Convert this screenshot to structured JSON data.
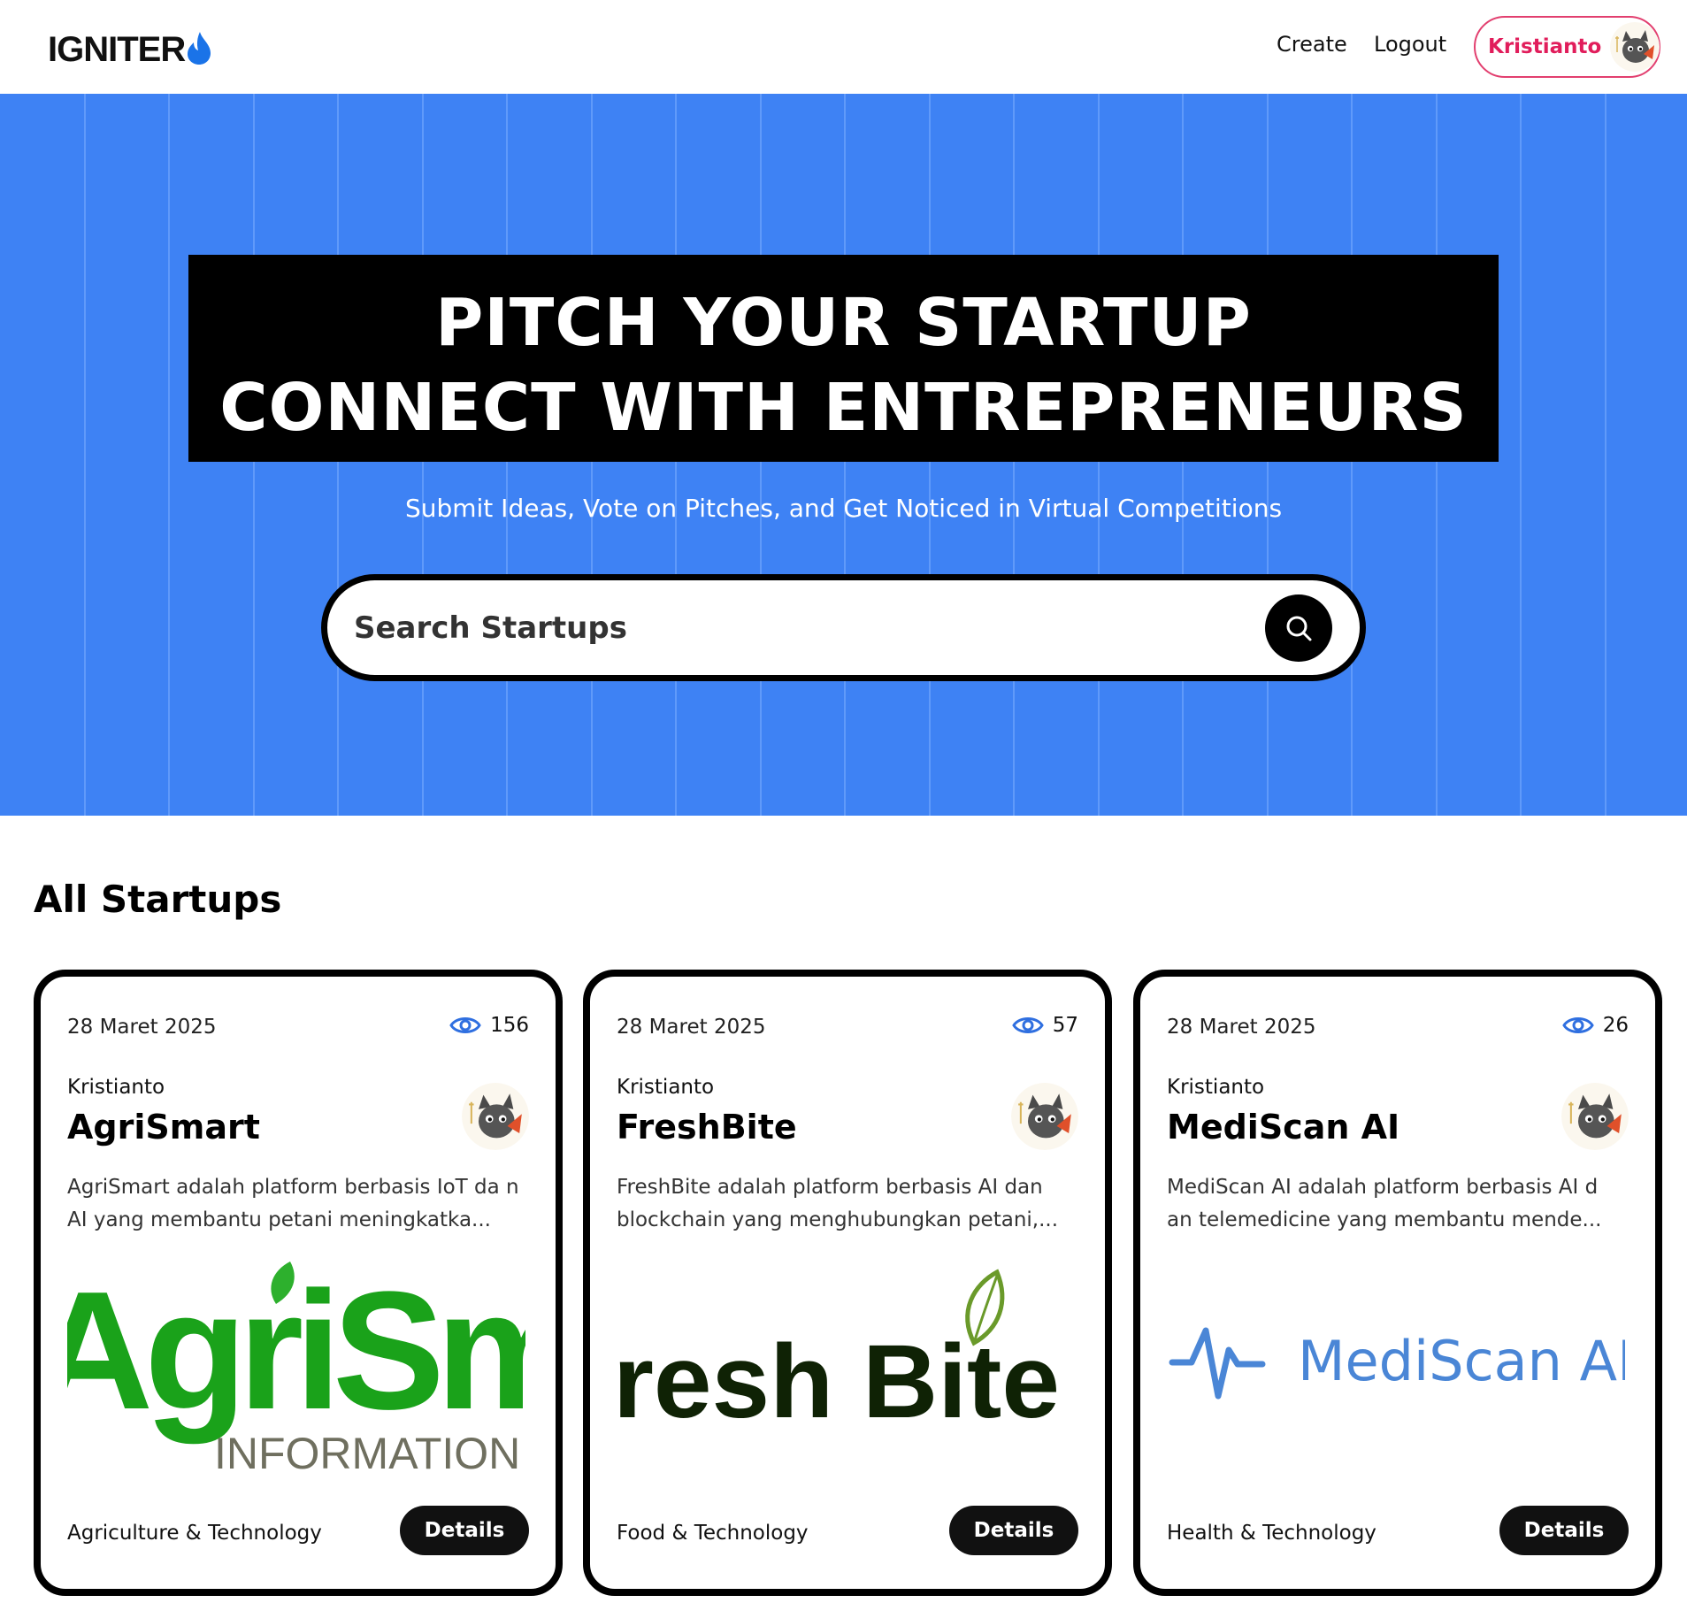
{
  "nav": {
    "logo_text": "IGNITER",
    "create_label": "Create",
    "logout_label": "Logout",
    "user_name": "Kristianto"
  },
  "hero": {
    "headline_line1": "PITCH YOUR STARTUP",
    "headline_line2": "CONNECT WITH ENTREPRENEURS",
    "subtitle": "Submit Ideas, Vote on Pitches, and Get Noticed in Virtual Competitions",
    "search_placeholder": "Search Startups"
  },
  "section": {
    "title": "All Startups"
  },
  "cards": [
    {
      "date": "28 Maret 2025",
      "views": "156",
      "author": "Kristianto",
      "title": "AgriSmart",
      "description": "AgriSmart adalah platform berbasis IoT da n AI yang membantu petani meningkatka...",
      "category": "Agriculture & Technology",
      "details_label": "Details",
      "logo_text_main": "AgriSm",
      "logo_text_sub": "INFORMATION"
    },
    {
      "date": "28 Maret 2025",
      "views": "57",
      "author": "Kristianto",
      "title": "FreshBite",
      "description": "FreshBite adalah platform berbasis AI dan blockchain yang menghubungkan petani,...",
      "category": "Food & Technology",
      "details_label": "Details",
      "logo_text_main": "resh Bite"
    },
    {
      "date": "28 Maret 2025",
      "views": "26",
      "author": "Kristianto",
      "title": "MediScan AI",
      "description": "MediScan AI adalah platform berbasis AI d an telemedicine yang membantu mende...",
      "category": "Health & Technology",
      "details_label": "Details",
      "logo_text_main": "MediScan AI"
    }
  ],
  "colors": {
    "hero_bg": "#3e82f4",
    "user_accent": "#e11d5b",
    "views_icon": "#2f6fe0",
    "agri_green_dark": "#1aa21a",
    "agri_green_light": "#7cf01a",
    "fresh_dark": "#0f2205",
    "medi_blue": "#4a86d6"
  },
  "icons": {
    "flame": "flame-icon",
    "search": "search-icon",
    "eye": "eye-icon"
  }
}
